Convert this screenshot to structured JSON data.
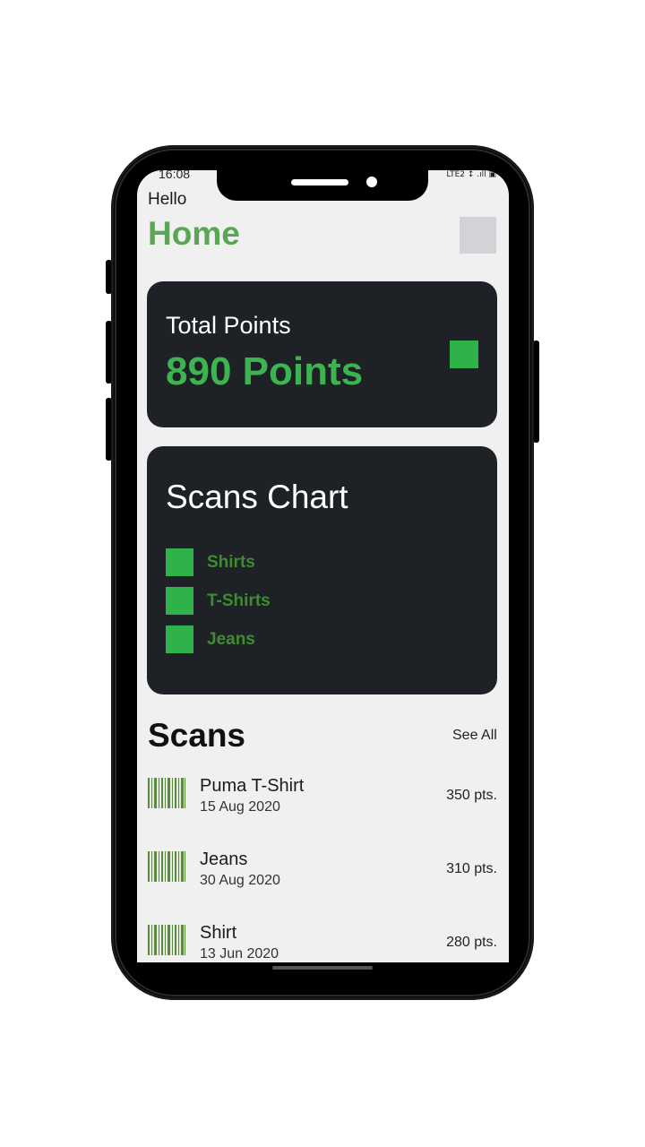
{
  "status_bar": {
    "time": "16:08",
    "icons": "LTE2 ↕ .ıll ▣"
  },
  "header": {
    "greeting": "Hello",
    "title": "Home"
  },
  "points_card": {
    "label": "Total Points",
    "value": "890 Points"
  },
  "chart_card": {
    "title": "Scans Chart",
    "legend": [
      {
        "label": "Shirts"
      },
      {
        "label": "T-Shirts"
      },
      {
        "label": "Jeans"
      }
    ]
  },
  "scans": {
    "title": "Scans",
    "see_all": "See All",
    "items": [
      {
        "name": "Puma T-Shirt",
        "date": "15 Aug 2020",
        "points": "350 pts."
      },
      {
        "name": "Jeans",
        "date": "30 Aug 2020",
        "points": "310 pts."
      },
      {
        "name": "Shirt",
        "date": "13 Jun 2020",
        "points": "280 pts."
      }
    ]
  },
  "colors": {
    "accent_green": "#5ca456",
    "card_bg": "#1e2227",
    "points_green": "#3cb550",
    "legend_text": "#3d8c2e"
  }
}
